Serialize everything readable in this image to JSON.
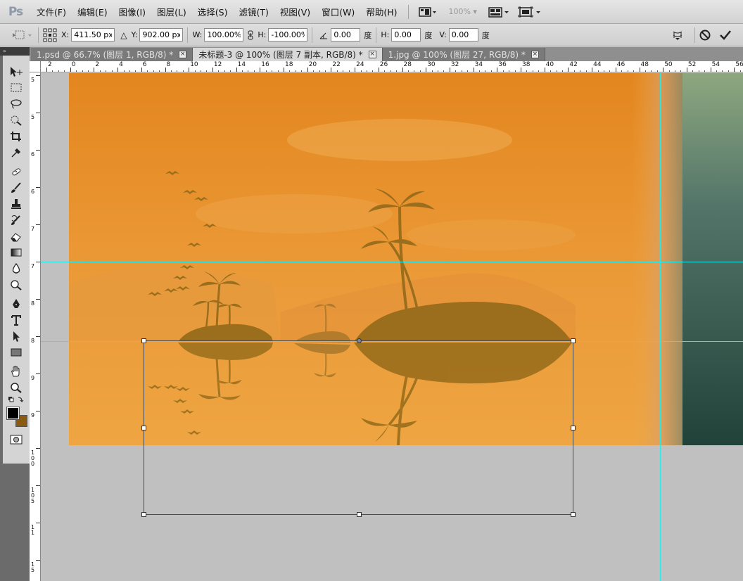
{
  "app": {
    "logo": "Ps"
  },
  "menubar": {
    "items": [
      {
        "label": "文件(F)"
      },
      {
        "label": "编辑(E)"
      },
      {
        "label": "图像(I)"
      },
      {
        "label": "图层(L)"
      },
      {
        "label": "选择(S)"
      },
      {
        "label": "滤镜(T)"
      },
      {
        "label": "视图(V)"
      },
      {
        "label": "窗口(W)"
      },
      {
        "label": "帮助(H)"
      }
    ],
    "zoom": "100%"
  },
  "options": {
    "x_label": "X:",
    "x_value": "411.50 px",
    "y_label": "Y:",
    "y_value": "902.00 px",
    "w_label": "W:",
    "w_value": "100.00%",
    "h_label": "H:",
    "h_value": "-100.00%",
    "rot_value": "0.00",
    "rot_unit": "度",
    "hskew_label": "H:",
    "hskew_value": "0.00",
    "hskew_unit": "度",
    "vskew_label": "V:",
    "vskew_value": "0.00",
    "vskew_unit": "度"
  },
  "tabs": [
    {
      "label": "1.psd @ 66.7% (图层 1, RGB/8) *",
      "active": false
    },
    {
      "label": "未标题-3 @ 100% (图层 7 副本, RGB/8) *",
      "active": true
    },
    {
      "label": "1.jpg @ 100% (图层 27, RGB/8) *",
      "active": false
    }
  ],
  "ruler": {
    "h_labels": [
      "2",
      "0",
      "2",
      "4",
      "6",
      "8",
      "10",
      "12",
      "14",
      "16",
      "18",
      "20",
      "22",
      "24",
      "26",
      "28",
      "30",
      "32",
      "34",
      "36",
      "38",
      "40",
      "42",
      "44",
      "46",
      "48",
      "50",
      "52",
      "54",
      "56"
    ],
    "v_labels": [
      "5",
      "5",
      "6",
      "6",
      "7",
      "7",
      "8",
      "8",
      "9",
      "9",
      "1 0 0",
      "1 0 5",
      "1 1",
      "1 5"
    ]
  },
  "colors": {
    "sky_top": "#e3861f",
    "sky_bottom": "#eea542",
    "silhouette": "#9a6e1c",
    "guide": "#2ee6e6",
    "foreground_swatch": "#000000",
    "background_swatch": "#8a5a10"
  }
}
